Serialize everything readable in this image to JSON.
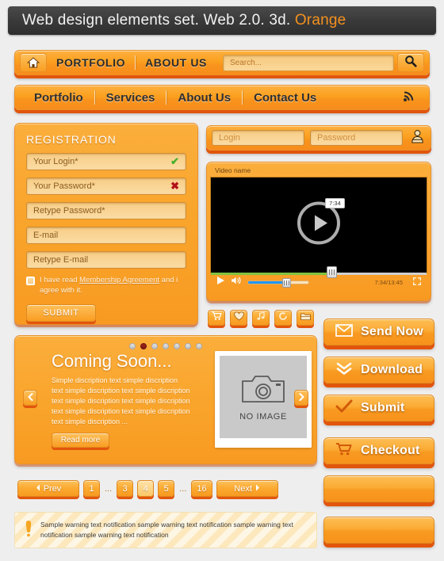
{
  "title": {
    "main": "Web design elements set. Web 2.0. 3d. ",
    "accent": "Orange"
  },
  "topnav": {
    "home_icon": "home-icon",
    "links": [
      "PORTFOLIO",
      "ABOUT US"
    ],
    "search_placeholder": "Search...",
    "search_icon": "magnifier-icon"
  },
  "mainnav": {
    "links": [
      "Portfolio",
      "Services",
      "About Us",
      "Contact Us"
    ],
    "rss_icon": "rss-icon"
  },
  "registration": {
    "title": "REGISTRATION",
    "fields": [
      {
        "label": "Your Login*",
        "mark": "✔",
        "mark_state": "ok"
      },
      {
        "label": "Your Password*",
        "mark": "✖",
        "mark_state": "bad"
      },
      {
        "label": "Retype Password*",
        "mark": "",
        "mark_state": "none"
      },
      {
        "label": "E-mail",
        "mark": "",
        "mark_state": "none"
      },
      {
        "label": "Retype E-mail",
        "mark": "",
        "mark_state": "none"
      }
    ],
    "agree_pre": "I have read ",
    "agree_link": "Membership Agreement",
    "agree_post": " and i agree with it.",
    "submit_label": "SUBMIT"
  },
  "login": {
    "login_placeholder": "Login",
    "password_placeholder": "Password",
    "user_icon": "user-icon"
  },
  "video": {
    "name": "Video name",
    "play_icon": "play-circle-icon",
    "tooltip_time": "7:34",
    "time_display": "7:34/13:45",
    "play_btn_icon": "play-icon",
    "volume_icon": "speaker-icon",
    "fullscreen_icon": "fullscreen-icon",
    "progress_percent": 56,
    "volume_percent": 62
  },
  "icon_buttons": [
    {
      "name": "cart-icon",
      "glyph": "cart"
    },
    {
      "name": "heart-icon",
      "glyph": "heart"
    },
    {
      "name": "music-note-icon",
      "glyph": "music"
    },
    {
      "name": "refresh-icon",
      "glyph": "refresh"
    },
    {
      "name": "folder-icon",
      "glyph": "folder"
    }
  ],
  "action_buttons": [
    {
      "label": "Send Now",
      "icon": "envelope-icon"
    },
    {
      "label": "Download",
      "icon": "double-chevron-down-icon"
    },
    {
      "label": "Submit",
      "icon": "check-icon"
    },
    {
      "label": "Checkout",
      "icon": "cart-icon"
    },
    {
      "label": "",
      "icon": ""
    },
    {
      "label": "",
      "icon": ""
    }
  ],
  "slider": {
    "dots_total": 7,
    "dot_active_index": 1,
    "heading": "Coming Soon...",
    "description": "Simple discription text simple discription text simple discription text simple discription text simple discription text simple discription text simple discription text simple discription text simple discription ...",
    "read_more_label": "Read more",
    "image_placeholder_label": "NO IMAGE",
    "camera_icon": "camera-icon",
    "prev_icon": "chevron-left-icon",
    "next_icon": "chevron-right-icon"
  },
  "pagination": {
    "prev_label": "Prev",
    "next_label": "Next",
    "ellipsis": "...",
    "pages": [
      "1",
      "...",
      "3",
      "4",
      "5",
      "...",
      "16"
    ],
    "active_page": "4"
  },
  "warning": {
    "icon": "exclamation-icon",
    "text": "Sample warning text notification sample warning text notification sample warning text notification sample warning text notification"
  },
  "colors": {
    "orange_light": "#fdc15c",
    "orange": "#f89a21",
    "orange_shadow": "#e2550c",
    "accent_text": "#f5911e",
    "title_bar": "#3a3a3a",
    "ok_green": "#43b02a",
    "error_red": "#b3131b",
    "progress_green": "#7fc241",
    "volume_blue": "#2196f3"
  }
}
